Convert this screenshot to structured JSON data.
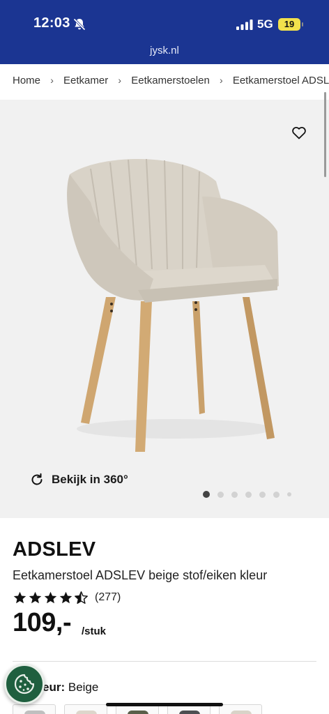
{
  "status_bar": {
    "time": "12:03",
    "network": "5G",
    "battery": "19",
    "icons": [
      "bell-slash-icon",
      "signal-icon"
    ]
  },
  "browser": {
    "url": "jysk.nl"
  },
  "breadcrumb": {
    "items": [
      "Home",
      "Eetkamer",
      "Eetkamerstoelen",
      "Eetkamerstoel ADSLEV"
    ],
    "separator_icon": "chevron-right-icon"
  },
  "gallery": {
    "favorite_icon": "heart-icon",
    "view360_label": "Bekijk in 360°",
    "view360_icon": "rotate-icon",
    "dots_total": 7,
    "active_dot": 1,
    "chair_fabric_color": "#d9d3c8",
    "chair_leg_color": "#c9a06a"
  },
  "product": {
    "brand": "ADSLEV",
    "subtitle": "Eetkamerstoel ADSLEV beige stof/eiken kleur",
    "rating_value": 4.5,
    "rating_count": "(277)",
    "price": "109,-",
    "unit": "/stuk"
  },
  "colour": {
    "label": "Kleur:",
    "value": "Beige",
    "swatch_colors": [
      "#bfbfbf",
      "#ddd6cb",
      "#5a5f4a",
      "#4d4f52",
      "#d9d3c8"
    ]
  },
  "cookie": {
    "icon": "cookie-icon"
  },
  "colors": {
    "header_blue": "#1b3592",
    "battery_yellow": "#f2e14c",
    "cookie_green": "#1f5f3f"
  }
}
